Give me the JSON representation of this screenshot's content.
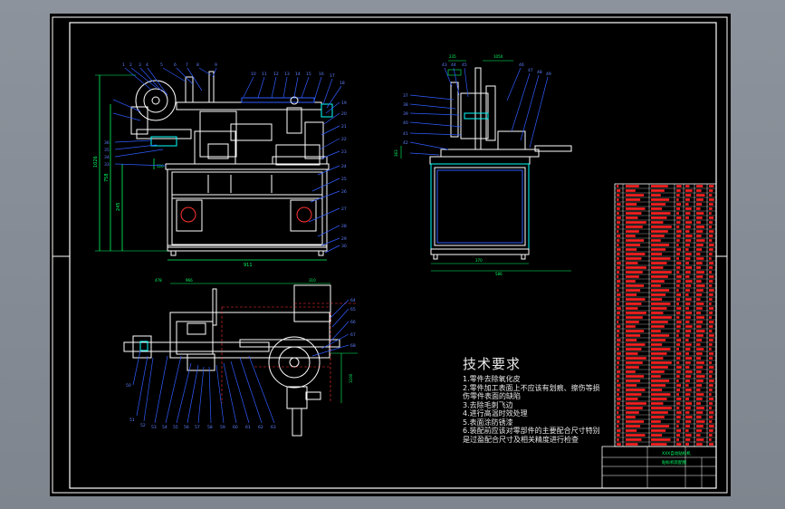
{
  "drawing": {
    "notes_title": "技术要求",
    "notes": [
      "1.零件去除氧化皮",
      "2.零件加工表面上不应该有划痕、擦伤等损",
      "伤零件表面的缺陷",
      "3.去除毛刺飞边",
      "4.进行高温时效处理",
      "5.表面涂防锈漆",
      "6.装配前应该对零部件的主要配合尺寸特别",
      "是过盈配合尺寸及相关精度进行检查"
    ],
    "dims": {
      "front_width": "911",
      "front_height": "1026",
      "front_mid_height": "758",
      "front_low_height": "245",
      "front_small": "126",
      "side_top_left": "235",
      "side_top_right": "1050",
      "side_width_inner": "370",
      "side_width_outer": "586",
      "side_left": "363",
      "plan_left": "478",
      "plan_mid": "966",
      "plan_right": "310",
      "plan_height": "1100"
    },
    "title_block": {
      "title": "XXX自动贴标机",
      "subtitle": "贴标机装配图"
    },
    "colors": {
      "background": "#000000",
      "frame": "#ffffff",
      "part": "#ffffff",
      "leader": "#2f5cff",
      "dimension": "#00ff66",
      "hidden": "#ff3333",
      "table_text": "#ff2020",
      "accent": "#00ffff"
    }
  }
}
